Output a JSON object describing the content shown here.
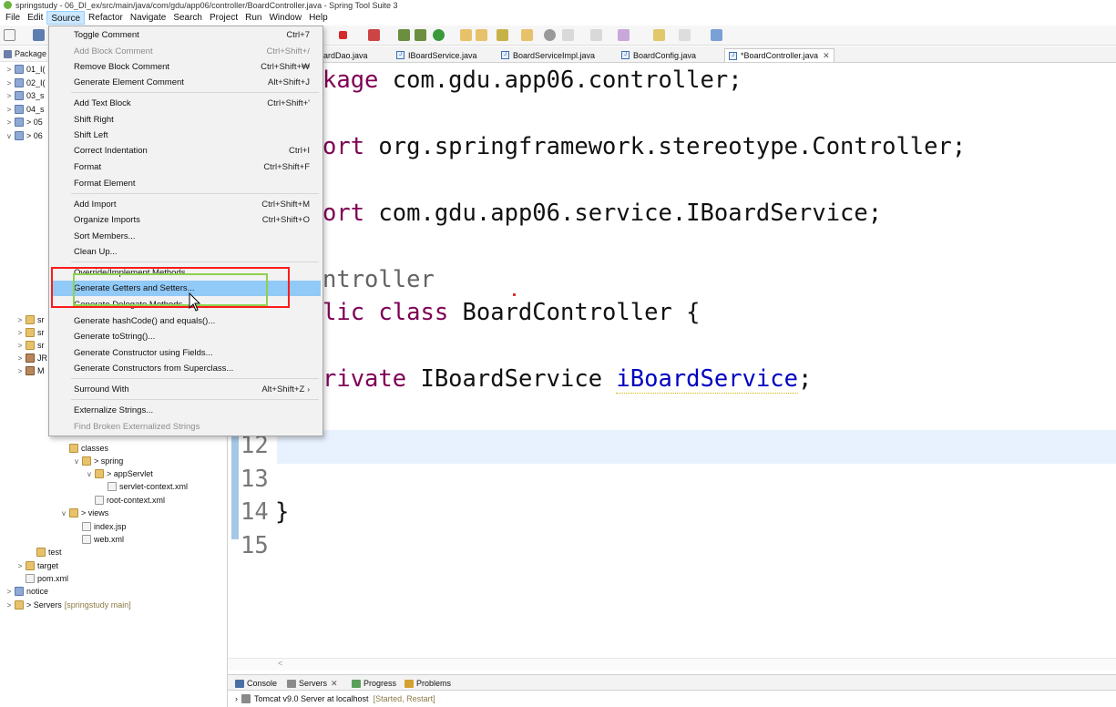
{
  "window": {
    "title": "springstudy - 06_DI_ex/src/main/java/com/gdu/app06/controller/BoardController.java - Spring Tool Suite 3"
  },
  "menubar": {
    "items": [
      "File",
      "Edit",
      "Source",
      "Refactor",
      "Navigate",
      "Search",
      "Project",
      "Run",
      "Window",
      "Help"
    ],
    "active": "Source"
  },
  "source_menu": {
    "items": [
      {
        "label": "Toggle Comment",
        "shortcut": "Ctrl+7"
      },
      {
        "label": "Add Block Comment",
        "shortcut": "Ctrl+Shift+/",
        "disabled": true
      },
      {
        "label": "Remove Block Comment",
        "shortcut": "Ctrl+Shift+₩"
      },
      {
        "label": "Generate Element Comment",
        "shortcut": "Alt+Shift+J"
      },
      {
        "label": "Add Text Block",
        "shortcut": "Ctrl+Shift+'"
      },
      {
        "label": "Shift Right",
        "shortcut": ""
      },
      {
        "label": "Shift Left",
        "shortcut": ""
      },
      {
        "label": "Correct Indentation",
        "shortcut": "Ctrl+I"
      },
      {
        "label": "Format",
        "shortcut": "Ctrl+Shift+F"
      },
      {
        "label": "Format Element",
        "shortcut": ""
      },
      {
        "label": "Add Import",
        "shortcut": "Ctrl+Shift+M"
      },
      {
        "label": "Organize Imports",
        "shortcut": "Ctrl+Shift+O"
      },
      {
        "label": "Sort Members...",
        "shortcut": ""
      },
      {
        "label": "Clean Up...",
        "shortcut": ""
      },
      {
        "label": "Override/Implement Methods...",
        "shortcut": ""
      },
      {
        "label": "Generate Getters and Setters...",
        "shortcut": "",
        "highlight": true
      },
      {
        "label": "Generate Delegate Methods...",
        "shortcut": ""
      },
      {
        "label": "Generate hashCode() and equals()...",
        "shortcut": ""
      },
      {
        "label": "Generate toString()...",
        "shortcut": ""
      },
      {
        "label": "Generate Constructor using Fields...",
        "shortcut": ""
      },
      {
        "label": "Generate Constructors from Superclass...",
        "shortcut": ""
      },
      {
        "label": "Surround With",
        "shortcut": "Alt+Shift+Z"
      },
      {
        "label": "Externalize Strings...",
        "shortcut": ""
      },
      {
        "label": "Find Broken Externalized Strings",
        "shortcut": "",
        "disabled": true
      }
    ]
  },
  "explorer": {
    "title": "Package",
    "rows": [
      {
        "text": "01_I(",
        "arrow": ">"
      },
      {
        "text": "02_I(",
        "arrow": ">"
      },
      {
        "text": "03_s",
        "arrow": ">"
      },
      {
        "text": "04_s",
        "arrow": ">"
      },
      {
        "text": "> 05",
        "arrow": ">"
      },
      {
        "text": "> 06",
        "arrow": "v"
      },
      {
        "text": "sr",
        "arrow": ">"
      },
      {
        "text": "sr",
        "arrow": ">"
      },
      {
        "text": "sr",
        "arrow": ">"
      },
      {
        "text": "JR",
        "arrow": ">"
      },
      {
        "text": "M",
        "arrow": ">"
      },
      {
        "text": "classes",
        "arrow": ""
      },
      {
        "text": "> spring",
        "arrow": "v"
      },
      {
        "text": "> appServlet",
        "arrow": "v"
      },
      {
        "text": "servlet-context.xml",
        "arrow": ""
      },
      {
        "text": "root-context.xml",
        "arrow": ""
      },
      {
        "text": "> views",
        "arrow": "v"
      },
      {
        "text": "index.jsp",
        "arrow": ""
      },
      {
        "text": "web.xml",
        "arrow": ""
      },
      {
        "text": "test",
        "arrow": ""
      },
      {
        "text": "target",
        "arrow": ">"
      },
      {
        "text": "pom.xml",
        "arrow": ""
      },
      {
        "text": "notice",
        "arrow": ">"
      },
      {
        "text": "> Servers",
        "suffix": "[springstudy main]",
        "arrow": ">"
      }
    ]
  },
  "editor_tabs": [
    {
      "label": "oardDao.java"
    },
    {
      "label": "IBoardService.java"
    },
    {
      "label": "BoardServiceImpl.java"
    },
    {
      "label": "BoardConfig.java"
    },
    {
      "label": "*BoardController.java",
      "active": true
    }
  ],
  "code": {
    "line1_kw": "kage",
    "line1_rest": " com.gdu.app06.controller;",
    "line2_kw": "ort",
    "line2_rest": " org.springframework.stereotype.Controller;",
    "line3_kw": "ort",
    "line3_rest": " com.gdu.app06.service.IBoardService;",
    "line4_anno": "ntroller",
    "line5_kw": "lic class",
    "line5_rest": " BoardController {",
    "line6_kw": "rivate",
    "line6_type": " IBoardService ",
    "line6_field": "iBoardService",
    "line6_end": ";",
    "line7": "}",
    "line_numbers": [
      "12",
      "13",
      "14",
      "15"
    ]
  },
  "bottom_panel": {
    "tabs": [
      "Console",
      "Servers",
      "Progress",
      "Problems"
    ],
    "server_name": "Tomcat v9.0 Server at localhost",
    "server_status": "[Started, Restart]"
  },
  "colors": {
    "menu_highlight": "#91c9f7",
    "annotation_red": "#ff1a1a",
    "annotation_green": "#8fd14f",
    "keyword": "#7f0055",
    "field": "#0000c0"
  }
}
